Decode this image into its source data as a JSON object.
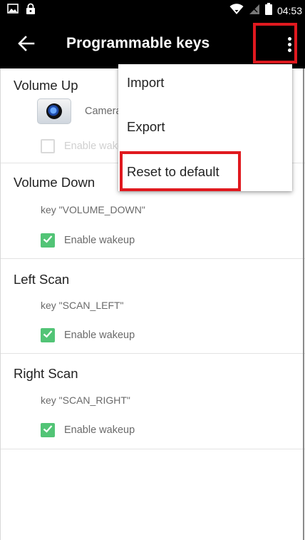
{
  "status_bar": {
    "time": "04:53",
    "icons": [
      "gallery-icon",
      "lock-icon",
      "wifi-icon",
      "no-signal-icon",
      "battery-icon"
    ]
  },
  "app_bar": {
    "title": "Programmable keys",
    "back_icon": "arrow-left-icon",
    "overflow_icon": "more-vertical-icon"
  },
  "keys": [
    {
      "title": "Volume Up",
      "app_name": "Camera",
      "app_icon": "camera-icon",
      "wakeup_label": "Enable wakeup",
      "wakeup_checked": false
    },
    {
      "title": "Volume Down",
      "key_code": "key \"VOLUME_DOWN\"",
      "wakeup_label": "Enable wakeup",
      "wakeup_checked": true
    },
    {
      "title": "Left Scan",
      "key_code": "key \"SCAN_LEFT\"",
      "wakeup_label": "Enable wakeup",
      "wakeup_checked": true
    },
    {
      "title": "Right Scan",
      "key_code": "key \"SCAN_RIGHT\"",
      "wakeup_label": "Enable wakeup",
      "wakeup_checked": true
    }
  ],
  "menu": {
    "items": [
      {
        "label": "Import"
      },
      {
        "label": "Export"
      },
      {
        "label": "Reset to default"
      }
    ]
  },
  "colors": {
    "app_bar": "#000000",
    "checkbox_checked": "#52c476",
    "highlight": "#e0191f"
  }
}
